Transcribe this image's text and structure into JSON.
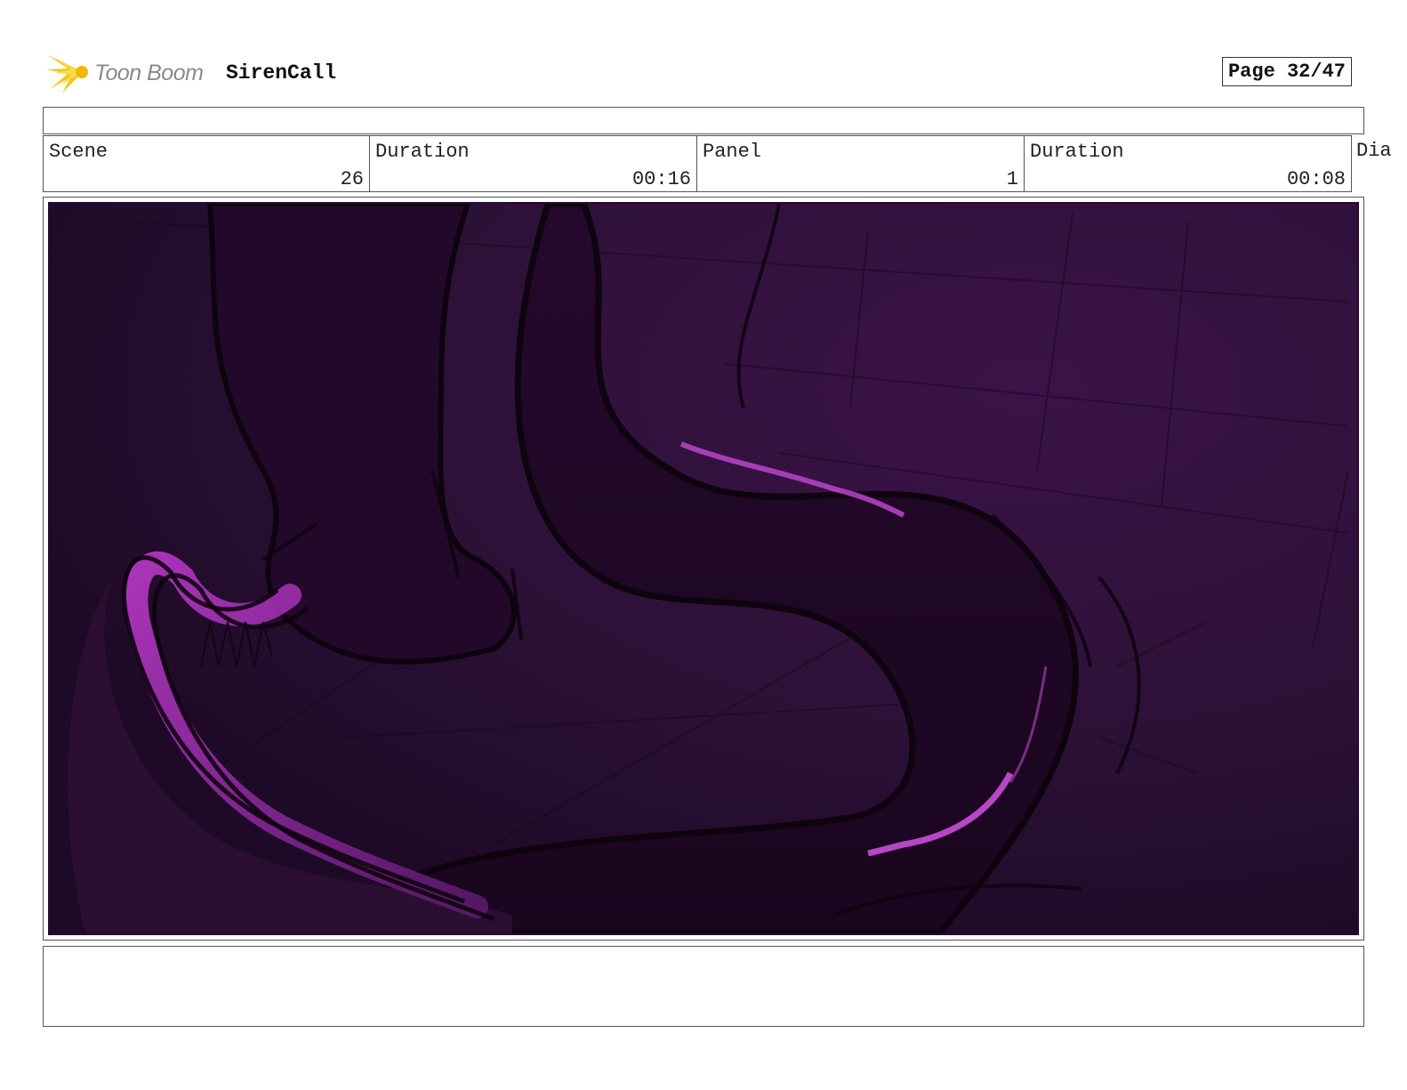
{
  "header": {
    "logo_text": "Toon Boom",
    "project_title": "SirenCall",
    "page_label": "Page 32/47"
  },
  "info": {
    "scene_label": "Scene",
    "scene_value": "26",
    "scene_duration_label": "Duration",
    "scene_duration_value": "00:16",
    "panel_label": "Panel",
    "panel_value": "1",
    "panel_duration_label": "Duration",
    "panel_duration_value": "00:08",
    "dialogue_label": "Dia"
  },
  "panel": {
    "icon": "storyboard-sketch-image",
    "colors": {
      "background": "#2b1236",
      "accent": "#a52bb5",
      "line": "#140414"
    }
  }
}
